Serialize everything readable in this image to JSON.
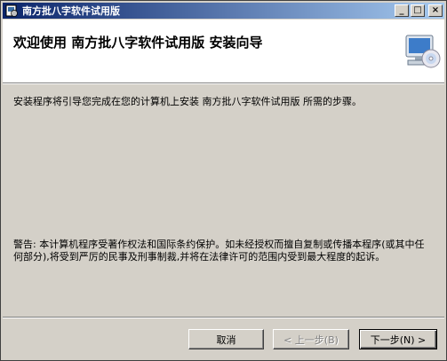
{
  "window": {
    "title": "南方批八字软件试用版",
    "icon": "installer-icon",
    "controls": {
      "minimize": "_",
      "maximize": "□",
      "close": "×"
    }
  },
  "header": {
    "title": "欢迎使用 南方批八字软件试用版 安装向导",
    "icon": "computer-cd-icon"
  },
  "body": {
    "intro": "安装程序将引导您完成在您的计算机上安装 南方批八字软件试用版 所需的步骤。",
    "warning": "警告: 本计算机程序受著作权法和国际条约保护。如未经授权而擅自复制或传播本程序(或其中任何部分),将受到严厉的民事及刑事制裁,并将在法律许可的范围内受到最大程度的起诉。"
  },
  "buttons": {
    "cancel": "取消",
    "back": "< 上一步(B)",
    "next": "下一步(N) >"
  }
}
